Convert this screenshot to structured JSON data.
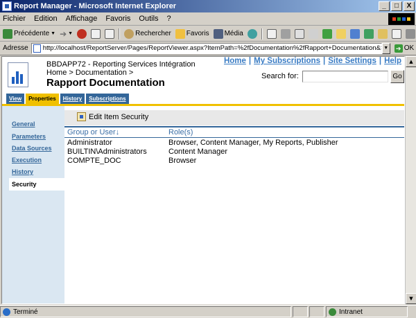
{
  "window": {
    "title": "Report Manager - Microsoft Internet Explorer",
    "min_label": "_",
    "max_label": "□",
    "close_label": "X"
  },
  "menu": [
    "Fichier",
    "Edition",
    "Affichage",
    "Favoris",
    "Outils",
    "?"
  ],
  "toolbar": {
    "back_label": "Précédente",
    "search_label": "Rechercher",
    "favorites_label": "Favoris",
    "media_label": "Média"
  },
  "address": {
    "label": "Adresse",
    "url": "http://localhost/ReportServer/Pages/ReportViewer.aspx?ItemPath=%2fDocumentation%2fRapport+Documentation&SelectedTabId=PropertiesTab",
    "go_label": "OK"
  },
  "header": {
    "site_name": "BBDAPP72 - Reporting Services Intégration",
    "breadcrumb": "Home > Documentation >",
    "page_title": "Rapport Documentation",
    "links": [
      "Home",
      "My Subscriptions",
      "Site Settings",
      "Help"
    ],
    "search_label": "Search for:",
    "search_value": "",
    "search_go": "Go"
  },
  "tabs": [
    {
      "label": "View"
    },
    {
      "label": "Properties"
    },
    {
      "label": "History"
    },
    {
      "label": "Subscriptions"
    }
  ],
  "nav": [
    "General",
    "Parameters",
    "Data Sources",
    "Execution",
    "History",
    "Security"
  ],
  "command": {
    "edit_security": "Edit Item Security"
  },
  "table": {
    "headers": [
      "Group or User↓",
      "Role(s)"
    ],
    "rows": [
      {
        "user": "Administrator",
        "roles": "Browser, Content Manager, My Reports, Publisher"
      },
      {
        "user": "BUILTIN\\Administrators",
        "roles": "Content Manager"
      },
      {
        "user": "COMPTE_DOC",
        "roles": "Browser"
      }
    ]
  },
  "status": {
    "text": "Terminé",
    "zone": "Intranet"
  },
  "colors": {
    "tab_blue": "#336699",
    "tab_active": "#f0c000",
    "nav_bg": "#dae7f2",
    "link": "#3a7cc4"
  }
}
